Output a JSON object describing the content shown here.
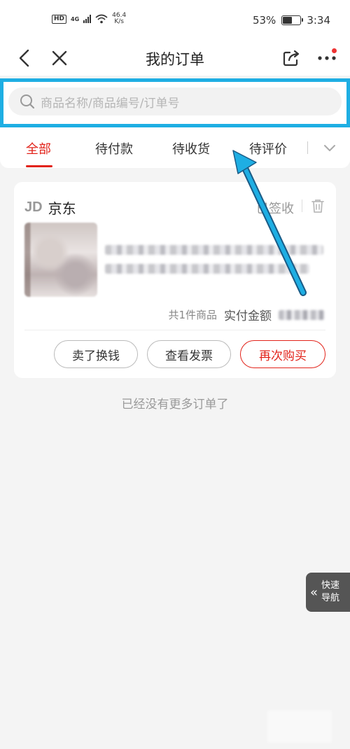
{
  "status_bar": {
    "hd": "HD",
    "network": "4G",
    "speed_value": "46.4",
    "speed_unit": "K/s",
    "battery_percent": "53%",
    "battery_level": 0.53,
    "time": "3:34"
  },
  "nav": {
    "title": "我的订单"
  },
  "search": {
    "placeholder": "商品名称/商品编号/订单号"
  },
  "tabs": [
    {
      "label": "全部",
      "active": true
    },
    {
      "label": "待付款"
    },
    {
      "label": "待收货"
    },
    {
      "label": "待评价"
    }
  ],
  "order": {
    "shop_logo": "JD",
    "shop_name": "京东",
    "status": "已签收",
    "item_count": "共1件商品",
    "paid_label": "实付金额"
  },
  "actions": {
    "sell": "卖了换钱",
    "invoice": "查看发票",
    "rebuy": "再次购买"
  },
  "footer": {
    "no_more": "已经没有更多订单了"
  },
  "quick_nav": {
    "line1": "快速",
    "line2": "导航"
  },
  "colors": {
    "accent_red": "#e2231a",
    "highlight_blue": "#1eaee3",
    "background": "#f4f4f4"
  }
}
